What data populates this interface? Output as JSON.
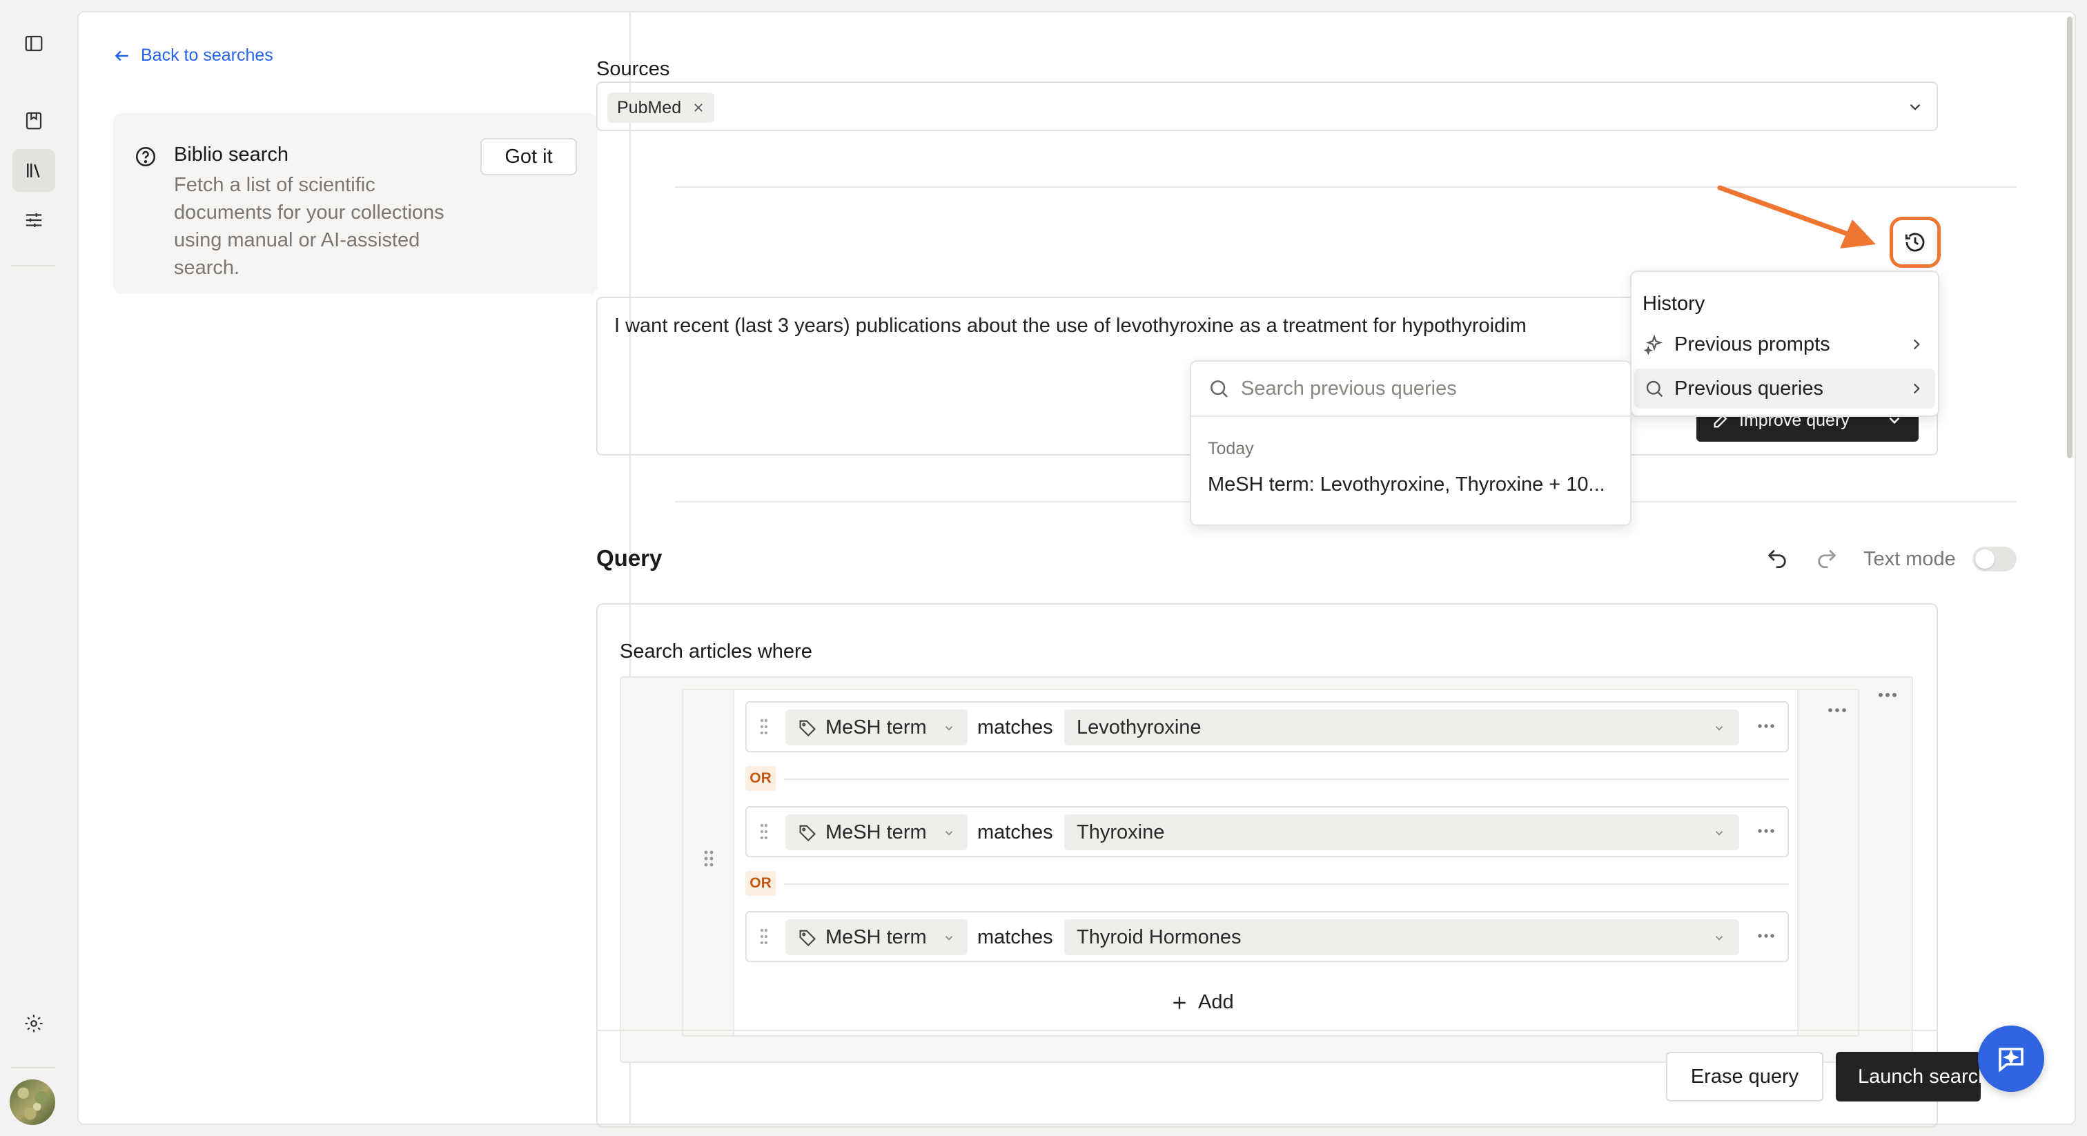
{
  "sidebar": {
    "icons": [
      "panel-toggle-icon",
      "bookmark-icon",
      "library-icon",
      "sliders-icon",
      "settings-icon"
    ]
  },
  "left_panel": {
    "back_label": "Back to searches",
    "info_title": "Biblio search",
    "info_description": "Fetch a list of scientific documents for your collections using manual or AI-assisted search.",
    "got_it_label": "Got it"
  },
  "sources": {
    "label": "Sources",
    "chips": [
      "PubMed"
    ]
  },
  "prompt": {
    "text": "I want recent (last 3 years) publications about the use of levothyroxine as a treatment for hypothyroidim",
    "improve_label": "Improve query"
  },
  "history_menu": {
    "title": "History",
    "items": [
      "Previous prompts",
      "Previous queries"
    ]
  },
  "previous_queries": {
    "search_placeholder": "Search previous queries",
    "group_label": "Today",
    "items": [
      "MeSH term: Levothyroxine, Thyroxine + 10..."
    ]
  },
  "query": {
    "label": "Query",
    "text_mode_label": "Text mode",
    "text_mode_on": false,
    "builder_title": "Search articles where",
    "connector": "OR",
    "criteria": [
      {
        "field": "MeSH term",
        "operator": "matches",
        "value": "Levothyroxine"
      },
      {
        "field": "MeSH term",
        "operator": "matches",
        "value": "Thyroxine"
      },
      {
        "field": "MeSH term",
        "operator": "matches",
        "value": "Thyroid Hormones"
      }
    ],
    "add_label": "Add",
    "erase_label": "Erase query",
    "launch_label": "Launch search"
  },
  "colors": {
    "accent": "#ee7630",
    "link": "#2563eb",
    "primary_button": "#232323",
    "fab": "#2f63e0",
    "or_badge_text": "#c25a12"
  }
}
